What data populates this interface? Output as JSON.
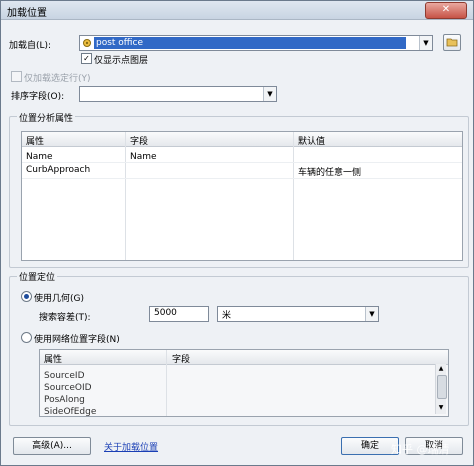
{
  "window": {
    "title": "加载位置",
    "close_glyph": "✕"
  },
  "load_from": {
    "label": "加载自(L):",
    "value": "post office",
    "only_points_label": "仅显示点图层",
    "only_points_checked": "✓"
  },
  "selected_only": {
    "label": "仅加载选定行(Y)"
  },
  "sort_field": {
    "label": "排序字段(O):",
    "value": ""
  },
  "location_analysis": {
    "group_label": "位置分析属性",
    "columns": [
      "属性",
      "字段",
      "默认值"
    ],
    "rows": [
      {
        "attr": "Name",
        "field": "Name",
        "default": ""
      },
      {
        "attr": "CurbApproach",
        "field": "",
        "default": "车辆的任意一侧"
      }
    ]
  },
  "location_position": {
    "group_label": "位置定位",
    "use_geometry_label": "使用几何(G)",
    "search_tolerance_label": "搜索容差(T):",
    "search_tolerance_value": "5000",
    "unit_value": "米",
    "use_network_label": "使用网络位置字段(N)",
    "network_columns": [
      "属性",
      "字段"
    ],
    "network_rows": [
      "SourceID",
      "SourceOID",
      "PosAlong",
      "SideOfEdge"
    ]
  },
  "footer": {
    "advanced_label": "高级(A)...",
    "about_link": "关于加载位置",
    "ok_label": "确定",
    "cancel_label": "取消"
  },
  "watermark": "知乎 @瑞清"
}
